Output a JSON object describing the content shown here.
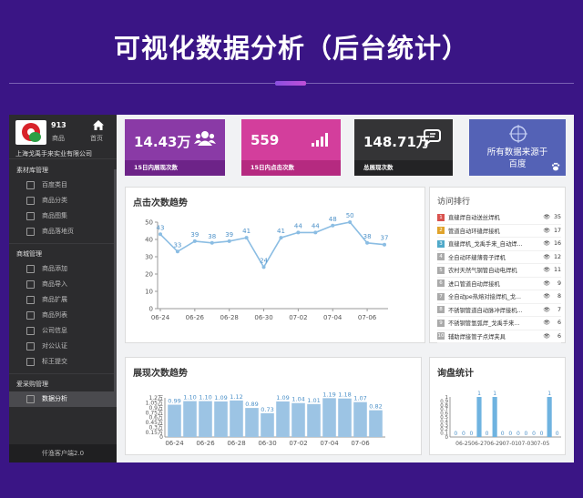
{
  "banner": {
    "title": "可视化数据分析（后台统计）"
  },
  "sidebar": {
    "product_count": "913",
    "product_count_label": "商品",
    "home_label": "首页",
    "company": "上海戈禹手来实业有限公司",
    "sections": [
      {
        "title": "素材库管理",
        "items": [
          "百度类目",
          "商品分类",
          "商品图集",
          "商品落地页"
        ]
      },
      {
        "title": "商城管理",
        "items": [
          "商品添加",
          "商品导入",
          "商品扩展",
          "商品列表",
          "公司信息",
          "对公认证",
          "标王提交"
        ]
      },
      {
        "title": "爱采购管理",
        "items": [
          "数据分析"
        ]
      }
    ],
    "active_item": "数据分析",
    "footer": "仟渔客户端2.0"
  },
  "cards": [
    {
      "value": "14.43万",
      "caption": "15日内展现次数",
      "icon": "users-icon"
    },
    {
      "value": "559",
      "caption": "15日内点击次数",
      "icon": "signal-bars-icon"
    },
    {
      "value": "148.71万",
      "caption": "总展现次数",
      "icon": "chat-icon"
    },
    {
      "line1": "所有数据来源于",
      "line2": "百度",
      "icon": "baidu-paw-icon"
    }
  ],
  "rank": {
    "title": "访问排行",
    "items": [
      {
        "rank": "1",
        "name": "直缝焊自动送丝焊机",
        "value": "35",
        "color": "#d9534f"
      },
      {
        "rank": "2",
        "name": "管道自动环缝焊接机",
        "value": "17",
        "color": "#e0a32a"
      },
      {
        "rank": "3",
        "name": "直缝焊机_戈禹手来_自动焊...",
        "value": "16",
        "color": "#4fa9c9"
      },
      {
        "rank": "4",
        "name": "全自动环缝薄膏子焊机",
        "value": "12",
        "color": "#aaaaaa"
      },
      {
        "rank": "5",
        "name": "农村天然气钢管自动电焊机",
        "value": "11",
        "color": "#aaaaaa"
      },
      {
        "rank": "6",
        "name": "进口管道自动焊接机",
        "value": "9",
        "color": "#aaaaaa"
      },
      {
        "rank": "7",
        "name": "全自动pe热熔对接焊机_戈...",
        "value": "8",
        "color": "#aaaaaa"
      },
      {
        "rank": "8",
        "name": "不锈钢管道自动脉冲焊接机...",
        "value": "7",
        "color": "#aaaaaa"
      },
      {
        "rank": "9",
        "name": "不锈钢管氩弧焊_戈禹手来...",
        "value": "6",
        "color": "#aaaaaa"
      },
      {
        "rank": "10",
        "name": "辅助焊接管子点焊夹具",
        "value": "6",
        "color": "#aaaaaa"
      }
    ]
  },
  "chart_data": [
    {
      "type": "line",
      "title": "点击次数趋势",
      "x": [
        "06-24",
        "06-25",
        "06-26",
        "06-27",
        "06-28",
        "06-29",
        "06-30",
        "07-01",
        "07-02",
        "07-03",
        "07-04",
        "07-05",
        "07-06",
        "07-07"
      ],
      "values": [
        43,
        33,
        39,
        38,
        39,
        41,
        24,
        41,
        44,
        44,
        48,
        50,
        38,
        37
      ],
      "xticks": [
        "06-24",
        "06-26",
        "06-28",
        "06-30",
        "07-02",
        "07-04",
        "07-06"
      ],
      "yticks": [
        "0",
        "10",
        "20",
        "30",
        "40",
        "50"
      ],
      "ylim": [
        0,
        50
      ],
      "color": "#8bbde3"
    },
    {
      "type": "bar",
      "title": "展现次数趋势",
      "x": [
        "06-24",
        "06-25",
        "06-26",
        "06-27",
        "06-28",
        "06-29",
        "06-30",
        "07-01",
        "07-02",
        "07-03",
        "07-04",
        "07-05",
        "07-06",
        "07-07"
      ],
      "values": [
        0.99,
        1.1,
        1.1,
        1.09,
        1.12,
        0.89,
        0.73,
        1.09,
        1.04,
        1.01,
        1.19,
        1.18,
        1.07,
        0.82
      ],
      "labels": [
        "0.99",
        "1.10",
        "1.10",
        "1.09",
        "1.12",
        "0.89",
        "0.73",
        "1.09",
        "1.04",
        "1.01",
        "1.19",
        "1.18",
        "1.07",
        "0.82"
      ],
      "xticks": [
        "06-24",
        "06-26",
        "06-28",
        "06-30",
        "07-02",
        "07-04",
        "07-06"
      ],
      "yticks": [
        "0",
        "0.15万",
        "0.3万",
        "0.45万",
        "0.6万",
        "0.75万",
        "0.9万",
        "1.05万",
        "1.2万"
      ],
      "ylim": [
        0,
        1.2
      ],
      "unit": "万",
      "color": "#9cc4e4"
    },
    {
      "type": "bar",
      "title": "询盘统计",
      "x": [
        "06-24",
        "06-25",
        "06-26",
        "06-27",
        "06-28",
        "06-29",
        "06-30",
        "07-01",
        "07-02",
        "07-03",
        "07-04",
        "07-05",
        "07-06",
        "07-07"
      ],
      "values": [
        0,
        0,
        0,
        1,
        0,
        1,
        0,
        0,
        0,
        0,
        0,
        0,
        1,
        0
      ],
      "xticks": [
        "06-25",
        "06-27",
        "06-29",
        "07-01",
        "07-03",
        "07-05"
      ],
      "yticks": [
        "0",
        "0.1",
        "0.2",
        "0.3",
        "0.4",
        "0.5",
        "0.6",
        "0.7",
        "0.8",
        "0.9",
        "1"
      ],
      "ylim": [
        0,
        1
      ],
      "color": "#6fb3e0"
    }
  ]
}
